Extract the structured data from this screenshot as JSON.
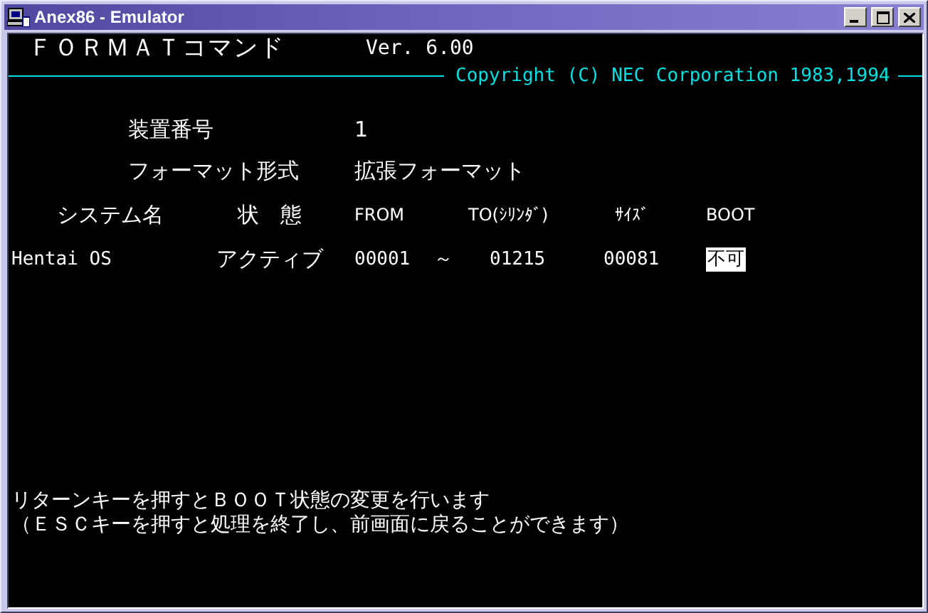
{
  "window": {
    "title": "Anex86 - Emulator"
  },
  "header": {
    "title": "ＦＯＲＭＡＴコマンド",
    "version": "Ver. 6.00",
    "copyright": "Copyright (C) NEC Corporation 1983,1994"
  },
  "fields": [
    {
      "label": "装置番号",
      "value": "1"
    },
    {
      "label": "フォーマット形式",
      "value": "拡張フォーマット"
    }
  ],
  "table": {
    "columns": [
      "システム名",
      "状　態",
      "FROM",
      "",
      "TO(ｼﾘﾝﾀﾞ)",
      "ｻｲｽﾞ",
      "BOOT"
    ],
    "rows": [
      {
        "cells": [
          "Hentai OS",
          "アクティブ",
          "00001",
          "～",
          "01215",
          "00081",
          "不可"
        ],
        "selected": true
      }
    ]
  },
  "messages": [
    "リターンキーを押すとＢＯＯＴ状態の変更を行います",
    "（ＥＳＣキーを押すと処理を終了し、前画面に戻ることができます）"
  ]
}
